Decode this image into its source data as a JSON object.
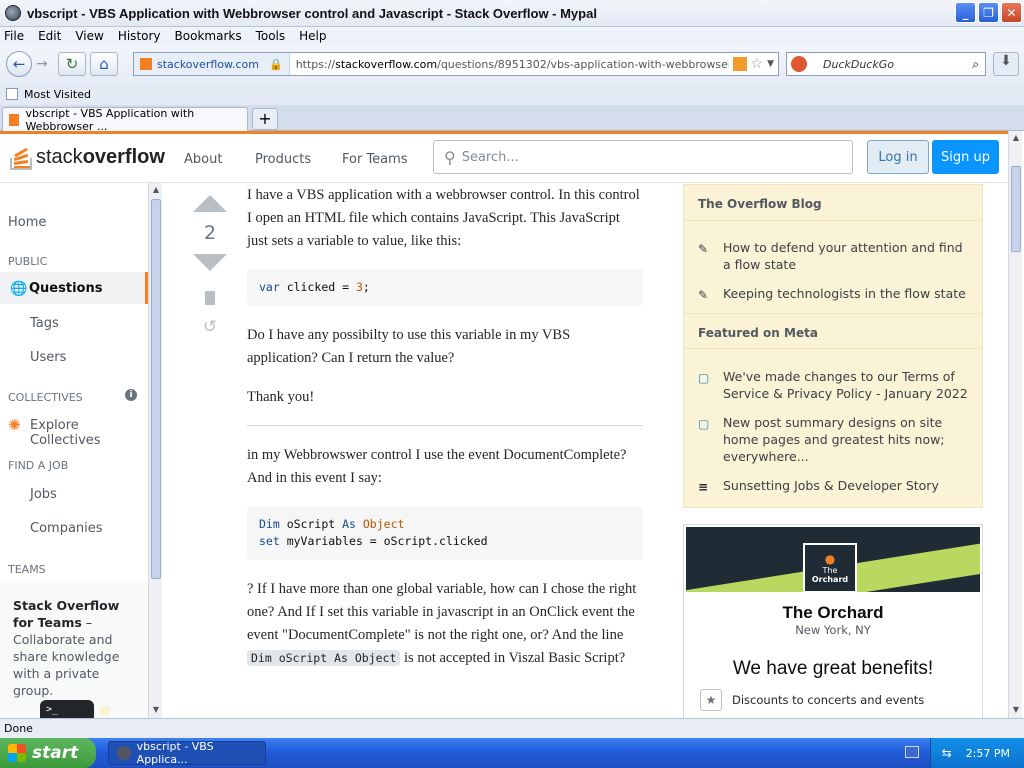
{
  "window": {
    "title": "vbscript - VBS Application with Webbrowser control and Javascript - Stack Overflow - Mypal"
  },
  "menu": [
    "File",
    "Edit",
    "View",
    "History",
    "Bookmarks",
    "Tools",
    "Help"
  ],
  "nav": {
    "site": "stackoverflow.com",
    "url_prefix": "https://",
    "url_host": "stackoverflow.com",
    "url_path": "/questions/8951302/vbs-application-with-webbrowser-control-and",
    "search_placeholder": "DuckDuckGo"
  },
  "bookmarks": {
    "most_visited": "Most Visited"
  },
  "tab": {
    "label": "vbscript - VBS Application with Webbrowser ..."
  },
  "so": {
    "logo_light": "stack",
    "logo_bold": "overflow",
    "about": "About",
    "products": "Products",
    "for_teams": "For Teams",
    "search_placeholder": "Search...",
    "login": "Log in",
    "signup": "Sign up"
  },
  "leftnav": {
    "home": "Home",
    "public": "PUBLIC",
    "questions": "Questions",
    "tags": "Tags",
    "users": "Users",
    "collectives": "COLLECTIVES",
    "explore": "Explore Collectives",
    "find_job": "FIND A JOB",
    "jobs": "Jobs",
    "companies": "Companies",
    "teams": "TEAMS",
    "teams_title": "Stack Overflow for Teams",
    "teams_dash": " –",
    "teams_desc": "Collaborate and share knowledge with a private group."
  },
  "post": {
    "votes": "2",
    "p1": "I have a VBS application with a webbrowser control. In this control I open an HTML file which contains JavaScript. This JavaScript just sets a variable to value, like this:",
    "code1_kw": "var",
    "code1_rest": " clicked = ",
    "code1_num": "3",
    "code1_end": ";",
    "p2": "Do I have any possibilty to use this variable in my VBS application? Can I return the value?",
    "p3": "Thank you!",
    "p4": "in my Webbrowswer control I use the event DocumentComplete? And in this event I say:",
    "code2_l1_kw": "Dim",
    "code2_l1_mid": " oScript ",
    "code2_l1_as": "As",
    "code2_l1_ty": " Object",
    "code2_l2_kw": "set",
    "code2_l2_rest": " myVariables = oScript.clicked",
    "p5a": "? If I have more than one global variable, how can I chose the right one? And If I set this variable in javascript in an OnClick event the event \"DocumentComplete\" is not the right one, or? And the line ",
    "p5_code": "Dim oScript As Object",
    "p5b": " is not accepted in Viszal Basic Script?"
  },
  "sidebar": {
    "blog_head": "The Overflow Blog",
    "blog1": "How to defend your attention and find a flow state",
    "blog2": "Keeping technologists in the flow state",
    "meta_head": "Featured on Meta",
    "meta1": "We've made changes to our Terms of Service & Privacy Policy - January 2022",
    "meta2": "New post summary designs on site home pages and greatest hits now; everywhere...",
    "meta3": "Sunsetting Jobs & Developer Story"
  },
  "ad": {
    "logo_line1": "The",
    "logo_line2": "Orchard",
    "name": "The Orchard",
    "location": "New York, NY",
    "tagline": "We have great benefits!",
    "benefit": "Discounts to concerts and events"
  },
  "status": "Done",
  "taskbar": {
    "start": "start",
    "task": "vbscript - VBS Applica...",
    "clock": "2:57 PM"
  }
}
